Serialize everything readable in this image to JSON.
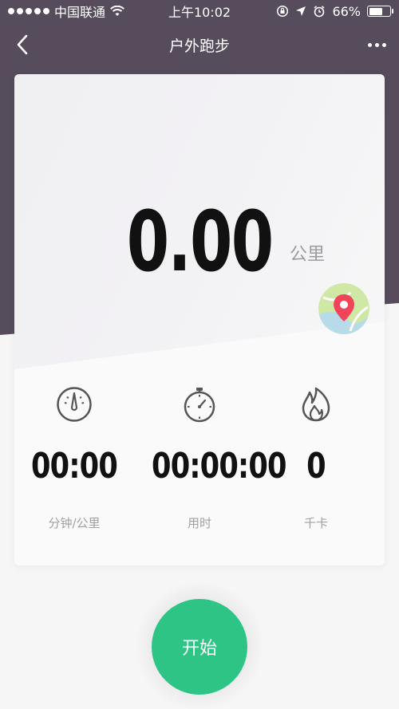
{
  "status_bar": {
    "carrier": "中国联通",
    "time": "上午10:02",
    "battery": "66%",
    "battery_level": 0.66
  },
  "nav": {
    "title": "户外跑步"
  },
  "distance": {
    "value": "0.00",
    "unit": "公里"
  },
  "stats": [
    {
      "icon": "speedometer-icon",
      "value": "00:00",
      "label": "分钟/公里"
    },
    {
      "icon": "stopwatch-icon",
      "value": "00:00:00",
      "label": "用时"
    },
    {
      "icon": "flame-icon",
      "value": "0",
      "label": "千卡"
    }
  ],
  "start_button": {
    "label": "开始"
  },
  "colors": {
    "header_bg": "#564c5c",
    "accent": "#2ec486",
    "map_pin": "#f0445a"
  }
}
